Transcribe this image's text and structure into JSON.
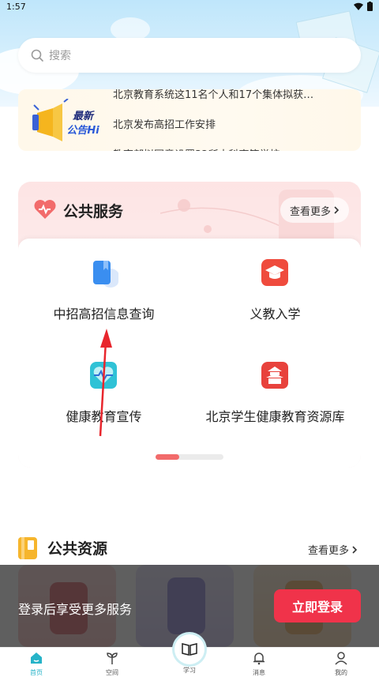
{
  "status_bar": {
    "time": "1:57"
  },
  "search": {
    "placeholder": "搜索"
  },
  "notice": {
    "badge_line1": "最新",
    "badge_line2": "公告Hi",
    "items": [
      "北京教育系统这11名个人和17个集体拟获…",
      "北京发布高招工作安排",
      "教育部拟同意设置32所本科高等学校"
    ]
  },
  "public_services": {
    "title": "公共服务",
    "more_label": "查看更多",
    "items": [
      {
        "label": "中招高招信息查询",
        "icon": "book-icon",
        "color": "#3a8ef0"
      },
      {
        "label": "义教入学",
        "icon": "graduation-cap-icon",
        "color": "#ef4b3d"
      },
      {
        "label": "健康教育宣传",
        "icon": "heartbeat-icon",
        "color": "#2fc2d6"
      },
      {
        "label": "北京学生健康教育资源库",
        "icon": "temple-icon",
        "color": "#e8423c"
      }
    ],
    "pager": {
      "current": 1,
      "total": 3
    }
  },
  "public_resources": {
    "title": "公共资源",
    "more_label": "查看更多"
  },
  "login_banner": {
    "text": "登录后享受更多服务",
    "button_label": "立即登录"
  },
  "tabbar": {
    "items": [
      {
        "label": "首页",
        "icon": "home-icon",
        "active": true
      },
      {
        "label": "空间",
        "icon": "sprout-icon",
        "active": false
      },
      {
        "label": "学习",
        "icon": "open-book-icon",
        "active": false
      },
      {
        "label": "消息",
        "icon": "bell-icon",
        "active": false
      },
      {
        "label": "我的",
        "icon": "user-icon",
        "active": false
      }
    ]
  },
  "colors": {
    "accent": "#f0334a",
    "tab_active": "#26b3c8",
    "arrow": "#e8262d"
  }
}
